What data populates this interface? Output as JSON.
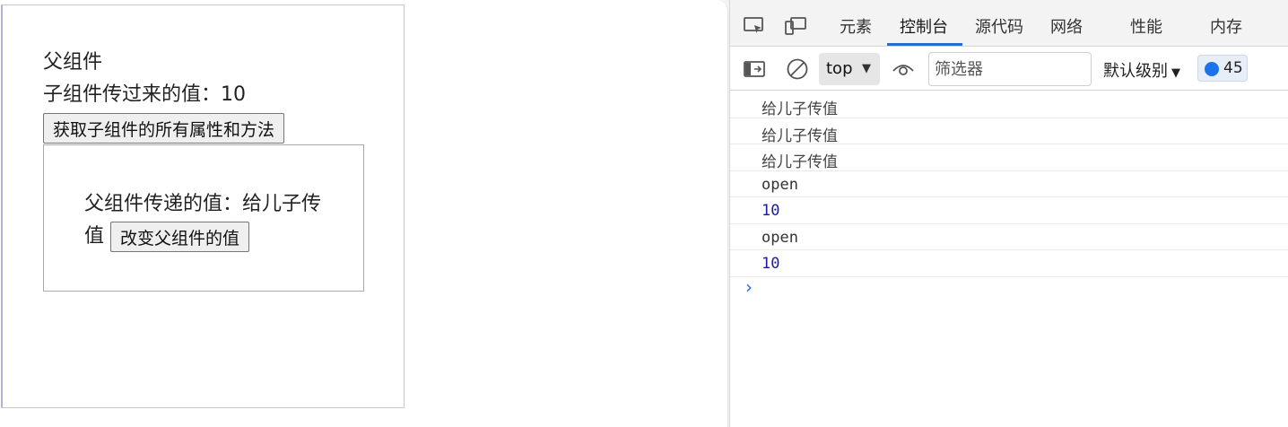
{
  "page": {
    "parent_title": "父组件",
    "child_value_label": "子组件传过来的值：",
    "child_value": "10",
    "get_child_button": "获取子组件的所有属性和方法",
    "child": {
      "parent_value_label": "父组件传递的值：",
      "parent_value": "给儿子传值",
      "change_button": "改变父组件的值"
    }
  },
  "devtools": {
    "tabs": [
      {
        "label": "元素",
        "icon": "elements"
      },
      {
        "label": "控制台",
        "active": true
      },
      {
        "label": "源代码"
      },
      {
        "label": "网络"
      },
      {
        "label": "性能"
      },
      {
        "label": "内存"
      }
    ],
    "toolbar": {
      "context": "top",
      "filter_placeholder": "筛选器",
      "level": "默认级别",
      "issues_count": "45"
    },
    "console": [
      {
        "text": "给儿子传值",
        "type": "string"
      },
      {
        "text": "给儿子传值",
        "type": "string"
      },
      {
        "text": "给儿子传值",
        "type": "string"
      },
      {
        "text": "open",
        "type": "string"
      },
      {
        "text": "10",
        "type": "number"
      },
      {
        "text": "open",
        "type": "string"
      },
      {
        "text": "10",
        "type": "number"
      }
    ],
    "prompt_symbol": "›"
  },
  "colors": {
    "accent": "#2b6bd1",
    "number": "#1a1aa6",
    "badge_dot": "#1a73e8"
  }
}
